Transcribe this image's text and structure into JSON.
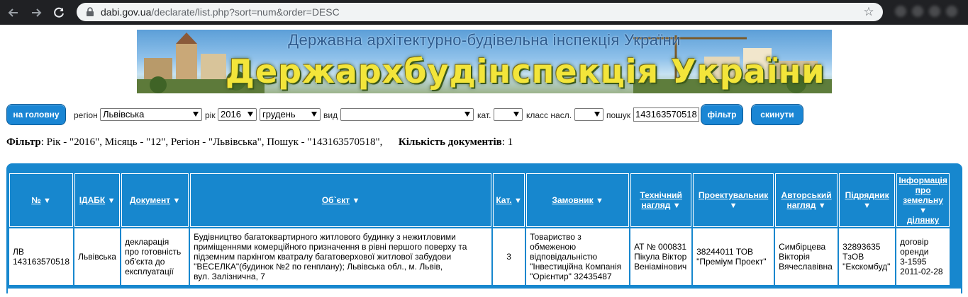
{
  "browser": {
    "url_host": "dabi.gov.ua",
    "url_path": "/declarate/list.php?sort=num&order=DESC"
  },
  "banner": {
    "subtitle": "Державна архітектурно-будівельна інспекція України",
    "title": "Держархбудінспекція України"
  },
  "filters": {
    "home_label": "на головну",
    "region_label": "регіон",
    "region_value": "Львівська",
    "year_label": "рік",
    "year_value": "2016",
    "month_value": "грудень",
    "kind_label": "вид",
    "kind_value": "",
    "cat_label": "кат.",
    "cat_value": "",
    "class_label": "класс насл.",
    "class_value": "",
    "search_label": "пошук",
    "search_value": "143163570518",
    "filter_button": "фільтр",
    "reset_button": "скинути"
  },
  "summary": {
    "filter_label": "Фільтр",
    "filter_text": ": Рік - \"2016\", Місяць - \"12\", Регіон - \"Львівська\", Пошук - \"143163570518\",",
    "count_label": "Кількість документів",
    "count_text": ": 1"
  },
  "table": {
    "headers": {
      "num": "№",
      "idabk": "ІДАБК",
      "document": "Документ",
      "object": "Об`єкт",
      "cat": "Кат.",
      "customer": "Замовник",
      "tech_l1": "Технічний",
      "tech_l2": "нагляд",
      "designer": "Проектувальник",
      "author_l1": "Авторський",
      "author_l2": "нагляд",
      "contractor": "Підрядник",
      "land_l1": "Інформація",
      "land_l2": "про",
      "land_l3": "земельну",
      "land_l4": "ділянку"
    },
    "row": {
      "num_l1": "ЛВ",
      "num_l2": "143163570518",
      "idabk": "Львівська",
      "doc_l1": "декларація",
      "doc_l2": "про готовність",
      "doc_l3": "об'єкта до",
      "doc_l4": "експлуатації",
      "obj_l1": "Будівництво багатоквартирного житлового будинку з нежитловими",
      "obj_l2": "приміщеннями комерційного призначення в рівні першого поверху та",
      "obj_l3": "підземним паркінгом кватралу багатоверхової житлової забудови",
      "obj_l4": "\"ВЕСЕЛКА\"(будинок №2 по генплану); Львівська обл., м. Львів,",
      "obj_l5": "вул. Залізнична, 7",
      "cat": "3",
      "cust_l1": "Товариство з",
      "cust_l2": "обмеженою",
      "cust_l3": "відповідальністю",
      "cust_l4": "\"Інвестиційна Компанія",
      "cust_l5": "\"Орієнтир\" 32435487",
      "tech_l1": "АТ № 000831",
      "tech_l2": "Пікула Віктор",
      "tech_l3": "Веніамінович",
      "des_l1": "38244011 ТОВ",
      "des_l2": "\"Преміум Проект\"",
      "auth_l1": "Симбірцева",
      "auth_l2": "Вікторія",
      "auth_l3": "Вячеславівна",
      "contr_l1": "32893635",
      "contr_l2": "ТзОВ",
      "contr_l3": "\"Екскомбуд\"",
      "land_l1": "договір",
      "land_l2": "оренди",
      "land_l3": "3-1595",
      "land_l4": "2011-02-28"
    }
  },
  "colors": {
    "accent_blue": "#1787ce",
    "banner_title": "#f3e53a"
  }
}
